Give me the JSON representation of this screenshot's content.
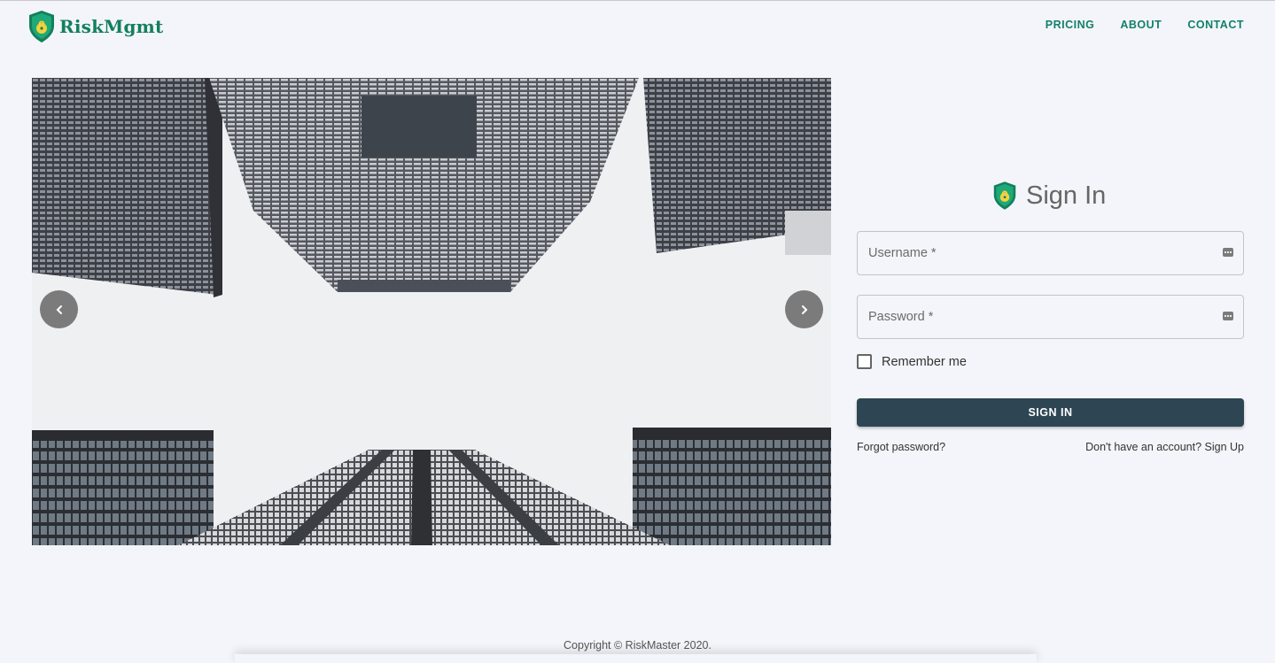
{
  "header": {
    "brand": "RiskMgmt",
    "nav": [
      "PRICING",
      "ABOUT",
      "CONTACT"
    ]
  },
  "carousel": {
    "image_description_icon": "skyscrapers-photo",
    "prev_icon": "chevron-left-icon",
    "next_icon": "chevron-right-icon"
  },
  "signin": {
    "title": "Sign In",
    "username_label": "Username *",
    "password_label": "Password *",
    "remember_label": "Remember me",
    "submit_label": "SIGN IN",
    "forgot_label": "Forgot password?",
    "signup_label": "Don't have an account? Sign Up"
  },
  "footer": {
    "copyright": "Copyright © RiskMaster 2020."
  },
  "colors": {
    "brand": "#12805c",
    "button": "#2e4654",
    "background": "#f4f5fa"
  }
}
